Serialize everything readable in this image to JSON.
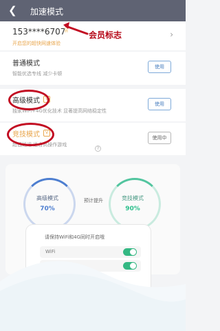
{
  "header": {
    "title": "加速模式",
    "back_icon": "back-icon"
  },
  "user": {
    "phone": "153****6707",
    "vip_hint": "开启您的超快网速体验",
    "chevron": "›"
  },
  "modes": [
    {
      "title": "普通模式",
      "desc": "智能优选专线 减少卡顿",
      "button": "使用"
    },
    {
      "title": "高级模式",
      "desc": "独家WiFi+4G优化技术 显著提高网络稳定性",
      "button": "使用"
    },
    {
      "title": "竞技模式",
      "desc": "超低延迟 适合高操作游戏",
      "button": "使用中"
    }
  ],
  "annotation": {
    "label": "会员标志"
  },
  "stats": {
    "left_title": "高级模式",
    "left_percent": "70%",
    "middle": "预计提升",
    "right_title": "竞技模式",
    "right_percent": "90%"
  },
  "device": {
    "title": "请保持WiFi和4G同时开启哦",
    "wifi": "WiFi",
    "g4": "4G"
  }
}
